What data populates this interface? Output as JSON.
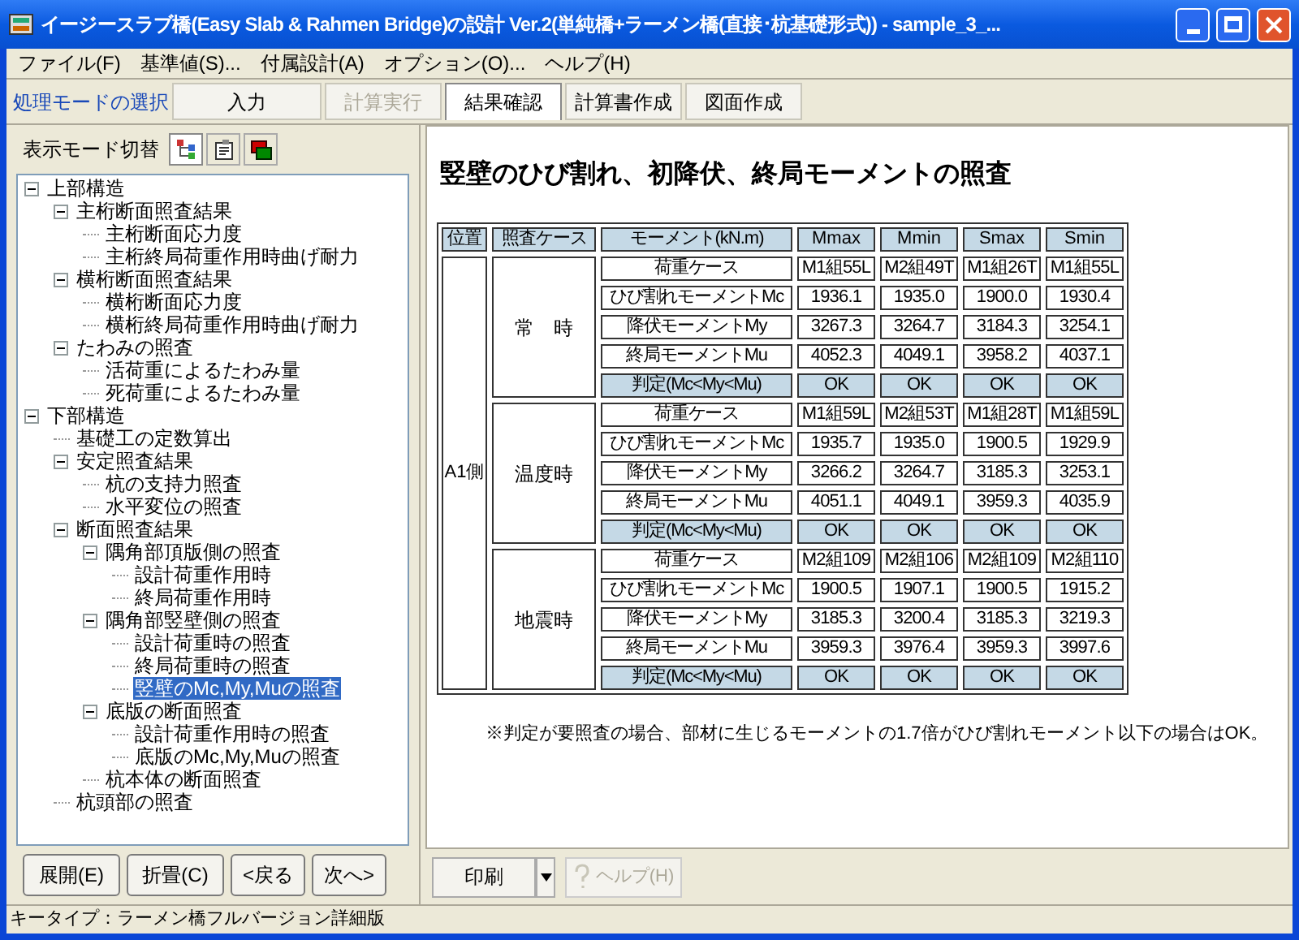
{
  "window": {
    "title": "イージースラブ橋(Easy Slab & Rahmen Bridge)の設計 Ver.2(単純橋+ラーメン橋(直接･杭基礎形式)) - sample_3_..."
  },
  "menu": [
    "ファイル(F)",
    "基準値(S)...",
    "付属設計(A)",
    "オプション(O)...",
    "ヘルプ(H)"
  ],
  "mode_bar": {
    "label": "処理モードの選択",
    "modes": [
      {
        "label": "入力",
        "selected": false,
        "disabled": false
      },
      {
        "label": "計算実行",
        "selected": false,
        "disabled": true
      },
      {
        "label": "結果確認",
        "selected": true,
        "disabled": false
      },
      {
        "label": "計算書作成",
        "selected": false,
        "disabled": false
      },
      {
        "label": "図面作成",
        "selected": false,
        "disabled": false
      }
    ]
  },
  "display_mode": {
    "label": "表示モード切替"
  },
  "tree": [
    {
      "label": "上部構造",
      "expanded": true,
      "selected": false,
      "children": [
        {
          "label": "主桁断面照査結果",
          "expanded": true,
          "selected": false,
          "children": [
            {
              "label": "主桁断面応力度",
              "selected": false
            },
            {
              "label": "主桁終局荷重作用時曲げ耐力",
              "selected": false
            }
          ]
        },
        {
          "label": "横桁断面照査結果",
          "expanded": true,
          "selected": false,
          "children": [
            {
              "label": "横桁断面応力度",
              "selected": false
            },
            {
              "label": "横桁終局荷重作用時曲げ耐力",
              "selected": false
            }
          ]
        },
        {
          "label": "たわみの照査",
          "expanded": true,
          "selected": false,
          "children": [
            {
              "label": "活荷重によるたわみ量",
              "selected": false
            },
            {
              "label": "死荷重によるたわみ量",
              "selected": false
            }
          ]
        }
      ]
    },
    {
      "label": "下部構造",
      "expanded": true,
      "selected": false,
      "children": [
        {
          "label": "基礎工の定数算出",
          "selected": false
        },
        {
          "label": "安定照査結果",
          "expanded": true,
          "selected": false,
          "children": [
            {
              "label": "杭の支持力照査",
              "selected": false
            },
            {
              "label": "水平変位の照査",
              "selected": false
            }
          ]
        },
        {
          "label": "断面照査結果",
          "expanded": true,
          "selected": false,
          "children": [
            {
              "label": "隅角部頂版側の照査",
              "expanded": true,
              "selected": false,
              "children": [
                {
                  "label": "設計荷重作用時",
                  "selected": false
                },
                {
                  "label": "終局荷重作用時",
                  "selected": false
                }
              ]
            },
            {
              "label": "隅角部竪壁側の照査",
              "expanded": true,
              "selected": false,
              "children": [
                {
                  "label": "設計荷重時の照査",
                  "selected": false
                },
                {
                  "label": "終局荷重時の照査",
                  "selected": false
                },
                {
                  "label": "竪壁のMc,My,Muの照査",
                  "selected": true
                }
              ]
            },
            {
              "label": "底版の断面照査",
              "expanded": true,
              "selected": false,
              "children": [
                {
                  "label": "設計荷重作用時の照査",
                  "selected": false
                },
                {
                  "label": "底版のMc,My,Muの照査",
                  "selected": false
                }
              ]
            },
            {
              "label": "杭本体の断面照査",
              "selected": false
            }
          ]
        },
        {
          "label": "杭頭部の照査",
          "selected": false
        }
      ]
    }
  ],
  "nav_buttons": [
    "展開(E)",
    "折畳(C)",
    "<戻る",
    "次へ>"
  ],
  "heading": "竪壁のひび割れ、初降伏、終局モーメントの照査",
  "table": {
    "columns": [
      "位置",
      "照査ケース",
      "モーメント(kN.m)",
      "Mmax",
      "Mmin",
      "Smax",
      "Smin"
    ],
    "position": "A1側",
    "cases": [
      {
        "name": "常　時",
        "rows": [
          {
            "kind": "plain",
            "label": "荷重ケース",
            "values": [
              "M1組55L",
              "M2組49T",
              "M1組26T",
              "M1組55L"
            ]
          },
          {
            "kind": "plain",
            "label": "ひび割れモーメントMc",
            "values": [
              "1936.1",
              "1935.0",
              "1900.0",
              "1930.4"
            ]
          },
          {
            "kind": "plain",
            "label": "降伏モーメントMy",
            "values": [
              "3267.3",
              "3264.7",
              "3184.3",
              "3254.1"
            ]
          },
          {
            "kind": "plain",
            "label": "終局モーメントMu",
            "values": [
              "4052.3",
              "4049.1",
              "3958.2",
              "4037.1"
            ]
          },
          {
            "kind": "judge",
            "label": "判定(Mc<My<Mu)",
            "values": [
              "OK",
              "OK",
              "OK",
              "OK"
            ]
          }
        ]
      },
      {
        "name": "温度時",
        "rows": [
          {
            "kind": "plain",
            "label": "荷重ケース",
            "values": [
              "M1組59L",
              "M2組53T",
              "M1組28T",
              "M1組59L"
            ]
          },
          {
            "kind": "plain",
            "label": "ひび割れモーメントMc",
            "values": [
              "1935.7",
              "1935.0",
              "1900.5",
              "1929.9"
            ]
          },
          {
            "kind": "plain",
            "label": "降伏モーメントMy",
            "values": [
              "3266.2",
              "3264.7",
              "3185.3",
              "3253.1"
            ]
          },
          {
            "kind": "plain",
            "label": "終局モーメントMu",
            "values": [
              "4051.1",
              "4049.1",
              "3959.3",
              "4035.9"
            ]
          },
          {
            "kind": "judge",
            "label": "判定(Mc<My<Mu)",
            "values": [
              "OK",
              "OK",
              "OK",
              "OK"
            ]
          }
        ]
      },
      {
        "name": "地震時",
        "rows": [
          {
            "kind": "plain",
            "label": "荷重ケース",
            "values": [
              "M2組109",
              "M2組106",
              "M2組109",
              "M2組110"
            ]
          },
          {
            "kind": "plain",
            "label": "ひび割れモーメントMc",
            "values": [
              "1900.5",
              "1907.1",
              "1900.5",
              "1915.2"
            ]
          },
          {
            "kind": "plain",
            "label": "降伏モーメントMy",
            "values": [
              "3185.3",
              "3200.4",
              "3185.3",
              "3219.3"
            ]
          },
          {
            "kind": "plain",
            "label": "終局モーメントMu",
            "values": [
              "3959.3",
              "3976.4",
              "3959.3",
              "3997.6"
            ]
          },
          {
            "kind": "judge",
            "label": "判定(Mc<My<Mu)",
            "values": [
              "OK",
              "OK",
              "OK",
              "OK"
            ]
          }
        ]
      }
    ]
  },
  "note": "※判定が要照査の場合、部材に生じるモーメントの1.7倍がひび割れモーメント以下の場合はOK。",
  "bottom_buttons": [
    {
      "kind": "print",
      "label": "印刷",
      "disabled": false
    },
    {
      "kind": "help",
      "label": "ヘルプ(H)",
      "disabled": true
    }
  ],
  "status_bar": "キータイプ：ラーメン橋フルバージョン詳細版"
}
